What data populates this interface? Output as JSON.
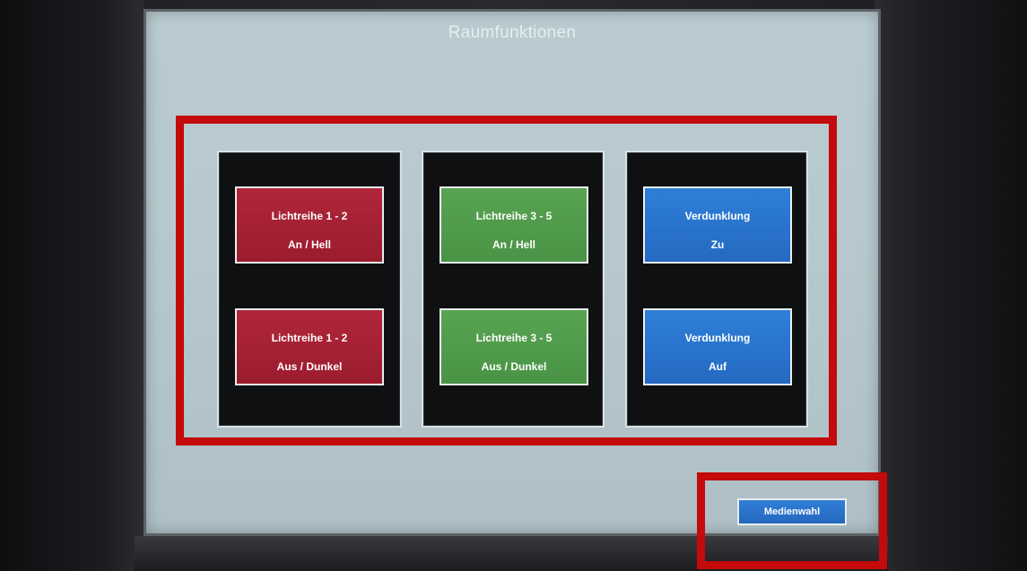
{
  "screen": {
    "title": "Raumfunktionen"
  },
  "panels": [
    {
      "name": "lights-1-2",
      "color": "#a8223a",
      "buttons": [
        {
          "line1": "Lichtreihe 1 - 2",
          "line2": "An / Hell"
        },
        {
          "line1": "Lichtreihe 1 - 2",
          "line2": "Aus / Dunkel"
        }
      ]
    },
    {
      "name": "lights-3-5",
      "color": "#52a04c",
      "buttons": [
        {
          "line1": "Lichtreihe 3 - 5",
          "line2": "An / Hell"
        },
        {
          "line1": "Lichtreihe 3 - 5",
          "line2": "Aus / Dunkel"
        }
      ]
    },
    {
      "name": "blinds",
      "color": "#2b76d0",
      "buttons": [
        {
          "line1": "Verdunklung",
          "line2": "Zu"
        },
        {
          "line1": "Verdunklung",
          "line2": "Auf"
        }
      ]
    }
  ],
  "footer": {
    "media_button_label": "Medienwahl"
  },
  "annotations": {
    "highlight_color": "#c40a0a"
  }
}
